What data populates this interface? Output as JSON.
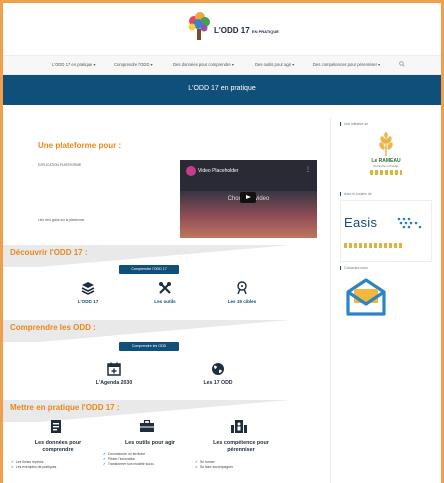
{
  "header": {
    "logo_text": "L'ODD 17",
    "logo_sub": "EN PRATIQUE"
  },
  "nav": {
    "items": [
      "L'ODD 17 en pratique ▾",
      "Comprendre l'ODD ▾",
      "Des données pour comprendre ▾",
      "Des outils pour agir ▾",
      "Des compétences pour pérenniser ▾"
    ],
    "search_icon": "search-icon"
  },
  "banner": {
    "title": "L'ODD 17 en pratique"
  },
  "platform": {
    "title": "Une plateforme pour :",
    "explanation": "EXPLICATION PLATEFORME",
    "link_text": "Lien vers guide sur la plateforme"
  },
  "video": {
    "title": "Video Placeholder",
    "choose": "Choose a video",
    "menu": "⋮"
  },
  "discover": {
    "title": "Découvrir l'ODD 17 :",
    "button": "Comprendre l'ODD 17",
    "features": [
      "L'ODD 17",
      "Les outils",
      "Les 19 cibles"
    ]
  },
  "understand": {
    "title": "Comprendre les ODD :",
    "button": "Comprendre les ODD",
    "features": [
      "L'Agenda 2030",
      "Les 17 ODD"
    ]
  },
  "practice": {
    "title": "Mettre en pratique l'ODD 17 :",
    "columns": [
      {
        "title_1": "Les données pour",
        "title_2": "comprendre",
        "items": [
          "Les fiches repères",
          "Les exemples de pratiques"
        ]
      },
      {
        "title_1": "Les outils pour agir",
        "title_2": "",
        "items": [
          "Coconstruire un territoire",
          "Piloter l'innovation",
          "Transformer son modèle socio-"
        ]
      },
      {
        "title_1": "Les compétence pour",
        "title_2": "pérenniser",
        "items": [
          "Se former",
          "Se faire accompagner"
        ]
      }
    ]
  },
  "sidebar": {
    "label_1": "Une initiative de",
    "rameau_name": "Le RAMEAU",
    "rameau_sub": "Recherche et Partage",
    "label_2": "Avec le soutien de",
    "easis_name": "Easis",
    "label_3": "Contactez-nous"
  },
  "colors": {
    "accent_orange": "#e8891c",
    "brand_blue": "#0f4f7a",
    "frame": "#f0a04a"
  }
}
